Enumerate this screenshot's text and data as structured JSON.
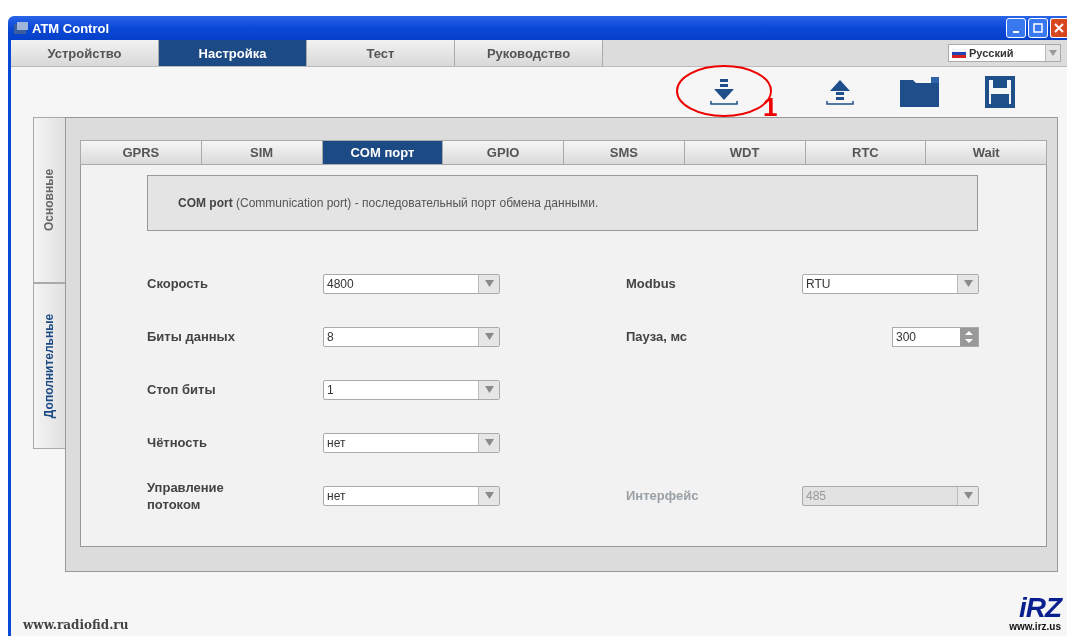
{
  "window": {
    "title": "ATM Control"
  },
  "main_tabs": [
    {
      "label": "Устройство",
      "selected": false
    },
    {
      "label": "Настройка",
      "selected": true
    },
    {
      "label": "Тест",
      "selected": false
    },
    {
      "label": "Руководство",
      "selected": false
    }
  ],
  "language": {
    "value": "Русский"
  },
  "annotation": {
    "label": "1"
  },
  "side_tabs": [
    {
      "label": "Основные",
      "selected": false
    },
    {
      "label": "Дополнительные",
      "selected": true
    }
  ],
  "tabs": [
    {
      "label": "GPRS",
      "selected": false
    },
    {
      "label": "SIM",
      "selected": false
    },
    {
      "label": "COM порт",
      "selected": true
    },
    {
      "label": "GPIO",
      "selected": false
    },
    {
      "label": "SMS",
      "selected": false
    },
    {
      "label": "WDT",
      "selected": false
    },
    {
      "label": "RTC",
      "selected": false
    },
    {
      "label": "Wait",
      "selected": false
    }
  ],
  "description": "**COM port** (Communication port) - последовательный порт обмена данными.",
  "rows": [
    {
      "left": {
        "label": "Скорость",
        "kind": "dropdown",
        "value": "4800",
        "disabled": false
      },
      "right": {
        "label": "Modbus",
        "kind": "dropdown",
        "value": "RTU",
        "disabled": false
      }
    },
    {
      "left": {
        "label": "Биты данных",
        "kind": "dropdown",
        "value": "8",
        "disabled": false
      },
      "right": {
        "label": "Пауза, мс",
        "kind": "spinner",
        "value": "300",
        "disabled": false
      }
    },
    {
      "left": {
        "label": "Стоп биты",
        "kind": "dropdown",
        "value": "1",
        "disabled": false
      }
    },
    {
      "left": {
        "label": "Чётность",
        "kind": "dropdown",
        "value": "нет",
        "disabled": false
      }
    },
    {
      "left": {
        "label": "Управление потоком",
        "kind": "dropdown",
        "value": "нет",
        "disabled": false
      },
      "right": {
        "label": "Интерфейс",
        "kind": "dropdown",
        "value": "485",
        "disabled": true
      }
    }
  ],
  "footer": {
    "website": "www.radiofid.ru",
    "logo": "iRZ",
    "logo_url": "www.irz.us"
  }
}
